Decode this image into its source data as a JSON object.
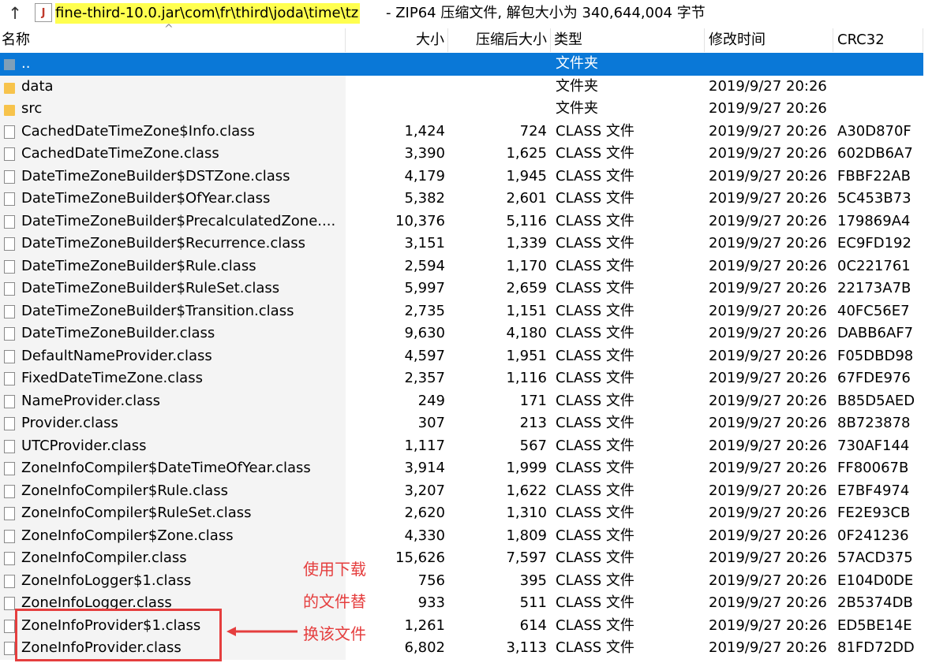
{
  "pathbar": {
    "up_glyph": "↑",
    "jar_glyph": "J",
    "path": "fine-third-10.0.jar\\com\\fr\\third\\joda\\time\\tz",
    "rest": " - ZIP64 压缩文件, 解包大小为 340,644,004 字节"
  },
  "header": {
    "name": "名称",
    "size": "大小",
    "packed": "压缩后大小",
    "type": "类型",
    "modified": "修改时间",
    "crc": "CRC32",
    "sort_glyph": "^"
  },
  "rows": [
    {
      "name": "..",
      "size": "",
      "packed": "",
      "type": "文件夹",
      "modified": "",
      "crc": "",
      "kind": "parent",
      "selected": true
    },
    {
      "name": "data",
      "size": "",
      "packed": "",
      "type": "文件夹",
      "modified": "2019/9/27 20:26",
      "crc": "",
      "kind": "folder"
    },
    {
      "name": "src",
      "size": "",
      "packed": "",
      "type": "文件夹",
      "modified": "2019/9/27 20:26",
      "crc": "",
      "kind": "folder"
    },
    {
      "name": "CachedDateTimeZone$Info.class",
      "size": "1,424",
      "packed": "724",
      "type": "CLASS 文件",
      "modified": "2019/9/27 20:26",
      "crc": "A30D870F",
      "kind": "file"
    },
    {
      "name": "CachedDateTimeZone.class",
      "size": "3,390",
      "packed": "1,625",
      "type": "CLASS 文件",
      "modified": "2019/9/27 20:26",
      "crc": "602DB6A7",
      "kind": "file"
    },
    {
      "name": "DateTimeZoneBuilder$DSTZone.class",
      "size": "4,179",
      "packed": "1,945",
      "type": "CLASS 文件",
      "modified": "2019/9/27 20:26",
      "crc": "FBBF22AB",
      "kind": "file"
    },
    {
      "name": "DateTimeZoneBuilder$OfYear.class",
      "size": "5,382",
      "packed": "2,601",
      "type": "CLASS 文件",
      "modified": "2019/9/27 20:26",
      "crc": "5C453B73",
      "kind": "file"
    },
    {
      "name": "DateTimeZoneBuilder$PrecalculatedZone....",
      "size": "10,376",
      "packed": "5,116",
      "type": "CLASS 文件",
      "modified": "2019/9/27 20:26",
      "crc": "179869A4",
      "kind": "file"
    },
    {
      "name": "DateTimeZoneBuilder$Recurrence.class",
      "size": "3,151",
      "packed": "1,339",
      "type": "CLASS 文件",
      "modified": "2019/9/27 20:26",
      "crc": "EC9FD192",
      "kind": "file"
    },
    {
      "name": "DateTimeZoneBuilder$Rule.class",
      "size": "2,594",
      "packed": "1,170",
      "type": "CLASS 文件",
      "modified": "2019/9/27 20:26",
      "crc": "0C221761",
      "kind": "file"
    },
    {
      "name": "DateTimeZoneBuilder$RuleSet.class",
      "size": "5,997",
      "packed": "2,659",
      "type": "CLASS 文件",
      "modified": "2019/9/27 20:26",
      "crc": "22173A7B",
      "kind": "file"
    },
    {
      "name": "DateTimeZoneBuilder$Transition.class",
      "size": "2,735",
      "packed": "1,151",
      "type": "CLASS 文件",
      "modified": "2019/9/27 20:26",
      "crc": "40FC56E7",
      "kind": "file"
    },
    {
      "name": "DateTimeZoneBuilder.class",
      "size": "9,630",
      "packed": "4,180",
      "type": "CLASS 文件",
      "modified": "2019/9/27 20:26",
      "crc": "DABB6AF7",
      "kind": "file"
    },
    {
      "name": "DefaultNameProvider.class",
      "size": "4,597",
      "packed": "1,951",
      "type": "CLASS 文件",
      "modified": "2019/9/27 20:26",
      "crc": "F05DBD98",
      "kind": "file"
    },
    {
      "name": "FixedDateTimeZone.class",
      "size": "2,357",
      "packed": "1,116",
      "type": "CLASS 文件",
      "modified": "2019/9/27 20:26",
      "crc": "67FDE976",
      "kind": "file"
    },
    {
      "name": "NameProvider.class",
      "size": "249",
      "packed": "171",
      "type": "CLASS 文件",
      "modified": "2019/9/27 20:26",
      "crc": "B85D5AED",
      "kind": "file"
    },
    {
      "name": "Provider.class",
      "size": "307",
      "packed": "213",
      "type": "CLASS 文件",
      "modified": "2019/9/27 20:26",
      "crc": "8B723878",
      "kind": "file"
    },
    {
      "name": "UTCProvider.class",
      "size": "1,117",
      "packed": "567",
      "type": "CLASS 文件",
      "modified": "2019/9/27 20:26",
      "crc": "730AF144",
      "kind": "file"
    },
    {
      "name": "ZoneInfoCompiler$DateTimeOfYear.class",
      "size": "3,914",
      "packed": "1,999",
      "type": "CLASS 文件",
      "modified": "2019/9/27 20:26",
      "crc": "FF80067B",
      "kind": "file"
    },
    {
      "name": "ZoneInfoCompiler$Rule.class",
      "size": "3,207",
      "packed": "1,622",
      "type": "CLASS 文件",
      "modified": "2019/9/27 20:26",
      "crc": "E7BF4974",
      "kind": "file"
    },
    {
      "name": "ZoneInfoCompiler$RuleSet.class",
      "size": "2,620",
      "packed": "1,310",
      "type": "CLASS 文件",
      "modified": "2019/9/27 20:26",
      "crc": "FE2E93CB",
      "kind": "file"
    },
    {
      "name": "ZoneInfoCompiler$Zone.class",
      "size": "4,330",
      "packed": "1,809",
      "type": "CLASS 文件",
      "modified": "2019/9/27 20:26",
      "crc": "0F241236",
      "kind": "file"
    },
    {
      "name": "ZoneInfoCompiler.class",
      "size": "15,626",
      "packed": "7,597",
      "type": "CLASS 文件",
      "modified": "2019/9/27 20:26",
      "crc": "57ACD375",
      "kind": "file"
    },
    {
      "name": "ZoneInfoLogger$1.class",
      "size": "756",
      "packed": "395",
      "type": "CLASS 文件",
      "modified": "2019/9/27 20:26",
      "crc": "E104D0DE",
      "kind": "file"
    },
    {
      "name": "ZoneInfoLogger.class",
      "size": "933",
      "packed": "511",
      "type": "CLASS 文件",
      "modified": "2019/9/27 20:26",
      "crc": "2B5374DB",
      "kind": "file"
    },
    {
      "name": "ZoneInfoProvider$1.class",
      "size": "1,261",
      "packed": "614",
      "type": "CLASS 文件",
      "modified": "2019/9/27 20:26",
      "crc": "ED5BE14E",
      "kind": "file"
    },
    {
      "name": "ZoneInfoProvider.class",
      "size": "6,802",
      "packed": "3,113",
      "type": "CLASS 文件",
      "modified": "2019/9/27 20:26",
      "crc": "81FD72DD",
      "kind": "file"
    }
  ],
  "annotation": {
    "lines": [
      "使用下载",
      "的文件替",
      "换该文件"
    ],
    "color": "#e53e3e"
  },
  "colors": {
    "selection": "#0a78d7",
    "path_highlight": "#ffff4f",
    "folder": "#f7c34b"
  }
}
